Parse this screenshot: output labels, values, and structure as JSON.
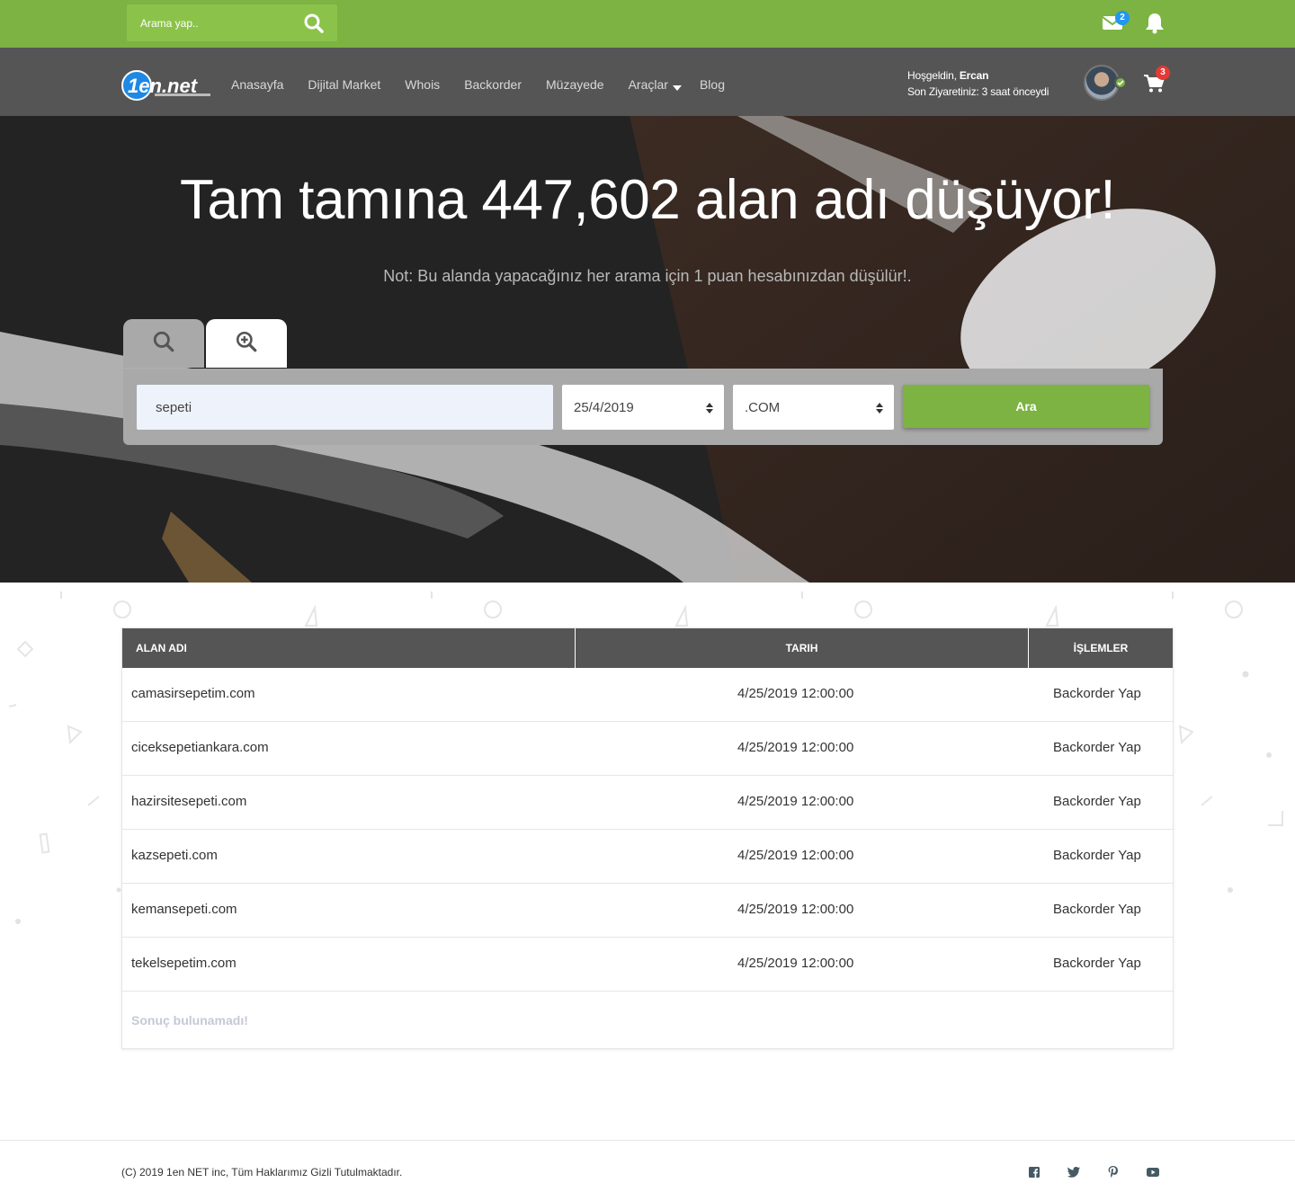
{
  "topbar": {
    "search_placeholder": "Arama yap..",
    "mail_badge": "2",
    "icons": [
      "search-icon",
      "mail-icon",
      "bell-icon"
    ]
  },
  "nav": {
    "logo_text": "1en.net",
    "items": [
      "Anasayfa",
      "Dijital Market",
      "Whois",
      "Backorder",
      "Müzayede",
      "Araçlar",
      "Blog"
    ],
    "welcome_prefix": "Hoşgeldin, ",
    "username": "Ercan",
    "last_visit": "Son Ziyaretiniz: 3 saat önceydi",
    "cart_badge": "3"
  },
  "hero": {
    "title": "Tam tamına 447,602 alan adı düşüyor!",
    "note": "Not: Bu alanda yapacağınız her arama için 1 puan hesabınızdan düşülür!.",
    "search_value": "sepeti",
    "date_value": "25/4/2019",
    "tld_value": ".COM",
    "submit_label": "Ara"
  },
  "table": {
    "headers": [
      "ALAN ADI",
      "TARIH",
      "İŞLEMLER"
    ],
    "rows": [
      {
        "domain": "camasirsepetim.com",
        "date": "4/25/2019 12:00:00",
        "action": "Backorder Yap"
      },
      {
        "domain": "ciceksepetiankara.com",
        "date": "4/25/2019 12:00:00",
        "action": "Backorder Yap"
      },
      {
        "domain": "hazirsitesepeti.com",
        "date": "4/25/2019 12:00:00",
        "action": "Backorder Yap"
      },
      {
        "domain": "kazsepeti.com",
        "date": "4/25/2019 12:00:00",
        "action": "Backorder Yap"
      },
      {
        "domain": "kemansepeti.com",
        "date": "4/25/2019 12:00:00",
        "action": "Backorder Yap"
      },
      {
        "domain": "tekelsepetim.com",
        "date": "4/25/2019 12:00:00",
        "action": "Backorder Yap"
      }
    ],
    "empty_text": "Sonuç bulunamadı!"
  },
  "footer": {
    "copyright": "(C) 2019 1en NET inc, Tüm Haklarımız Gizli Tutulmaktadır.",
    "social_icons": [
      "facebook-icon",
      "twitter-icon",
      "pinterest-icon",
      "youtube-icon"
    ]
  },
  "colors": {
    "accent": "#7cb342",
    "nav_bg": "#555555",
    "badge": "#e53935",
    "mail_badge": "#2196f3"
  }
}
